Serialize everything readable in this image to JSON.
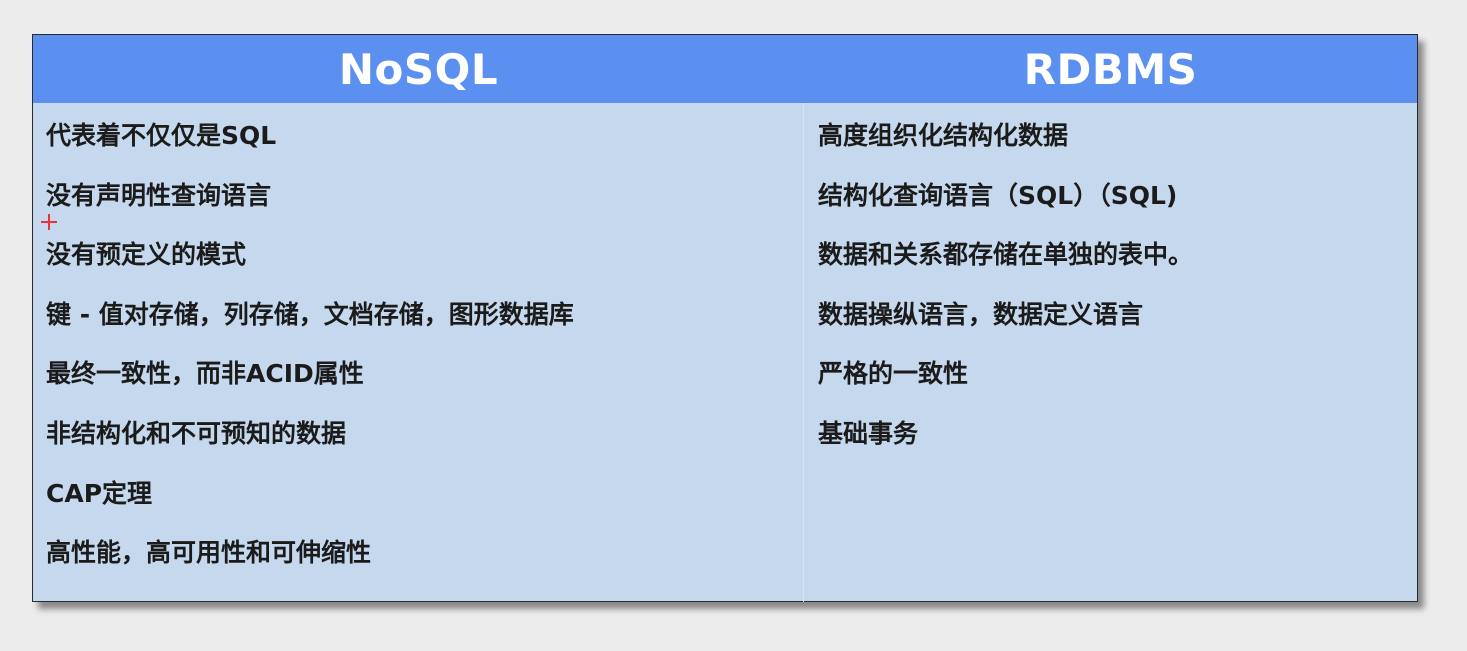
{
  "table": {
    "headers": {
      "left": "NoSQL",
      "right": "RDBMS"
    },
    "nosql_items": [
      "代表着不仅仅是SQL",
      "没有声明性查询语言",
      "没有预定义的模式",
      "键 - 值对存储，列存储，文档存储，图形数据库",
      "最终一致性，而非ACID属性",
      "非结构化和不可预知的数据",
      "CAP定理",
      "高性能，高可用性和可伸缩性"
    ],
    "rdbms_items": [
      "高度组织化结构化数据",
      "结构化查询语言（SQL）（SQL)",
      "数据和关系都存储在单独的表中。",
      "数据操纵语言，数据定义语言",
      "严格的一致性",
      "基础事务"
    ]
  },
  "colors": {
    "header_bg": "#5b8ff0",
    "body_bg": "#c5d8ed",
    "page_bg": "#ececec",
    "cursor": "#e8333a"
  }
}
